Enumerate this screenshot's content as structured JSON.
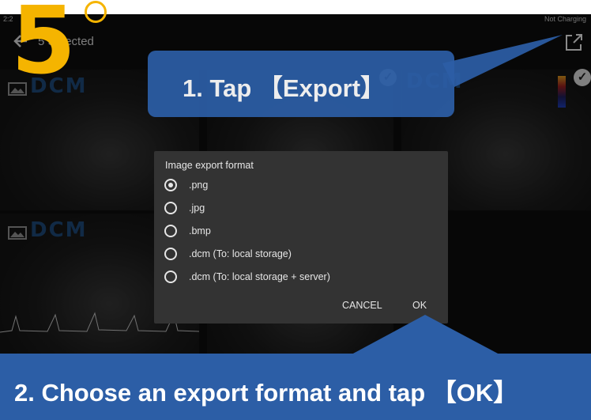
{
  "status_bar": {
    "time": "2:2",
    "battery": "Not Charging"
  },
  "header": {
    "selected_label": "5 Selected"
  },
  "thumbnails": {
    "logo_text": "DCM"
  },
  "dialog": {
    "title": "Image export format",
    "options": [
      ".png",
      ".jpg",
      ".bmp",
      ".dcm (To: local storage)",
      ".dcm (To: local storage + server)"
    ],
    "selected_index": 0,
    "cancel_label": "CANCEL",
    "ok_label": "OK"
  },
  "annotations": {
    "step_number": "5",
    "step1": "1. Tap 【Export】",
    "step2": "2. Choose an export format and tap 【OK】"
  },
  "colors": {
    "accent_orange": "#f5b400",
    "banner_blue": "#2c5ea6",
    "dialog_bg": "#333333"
  }
}
